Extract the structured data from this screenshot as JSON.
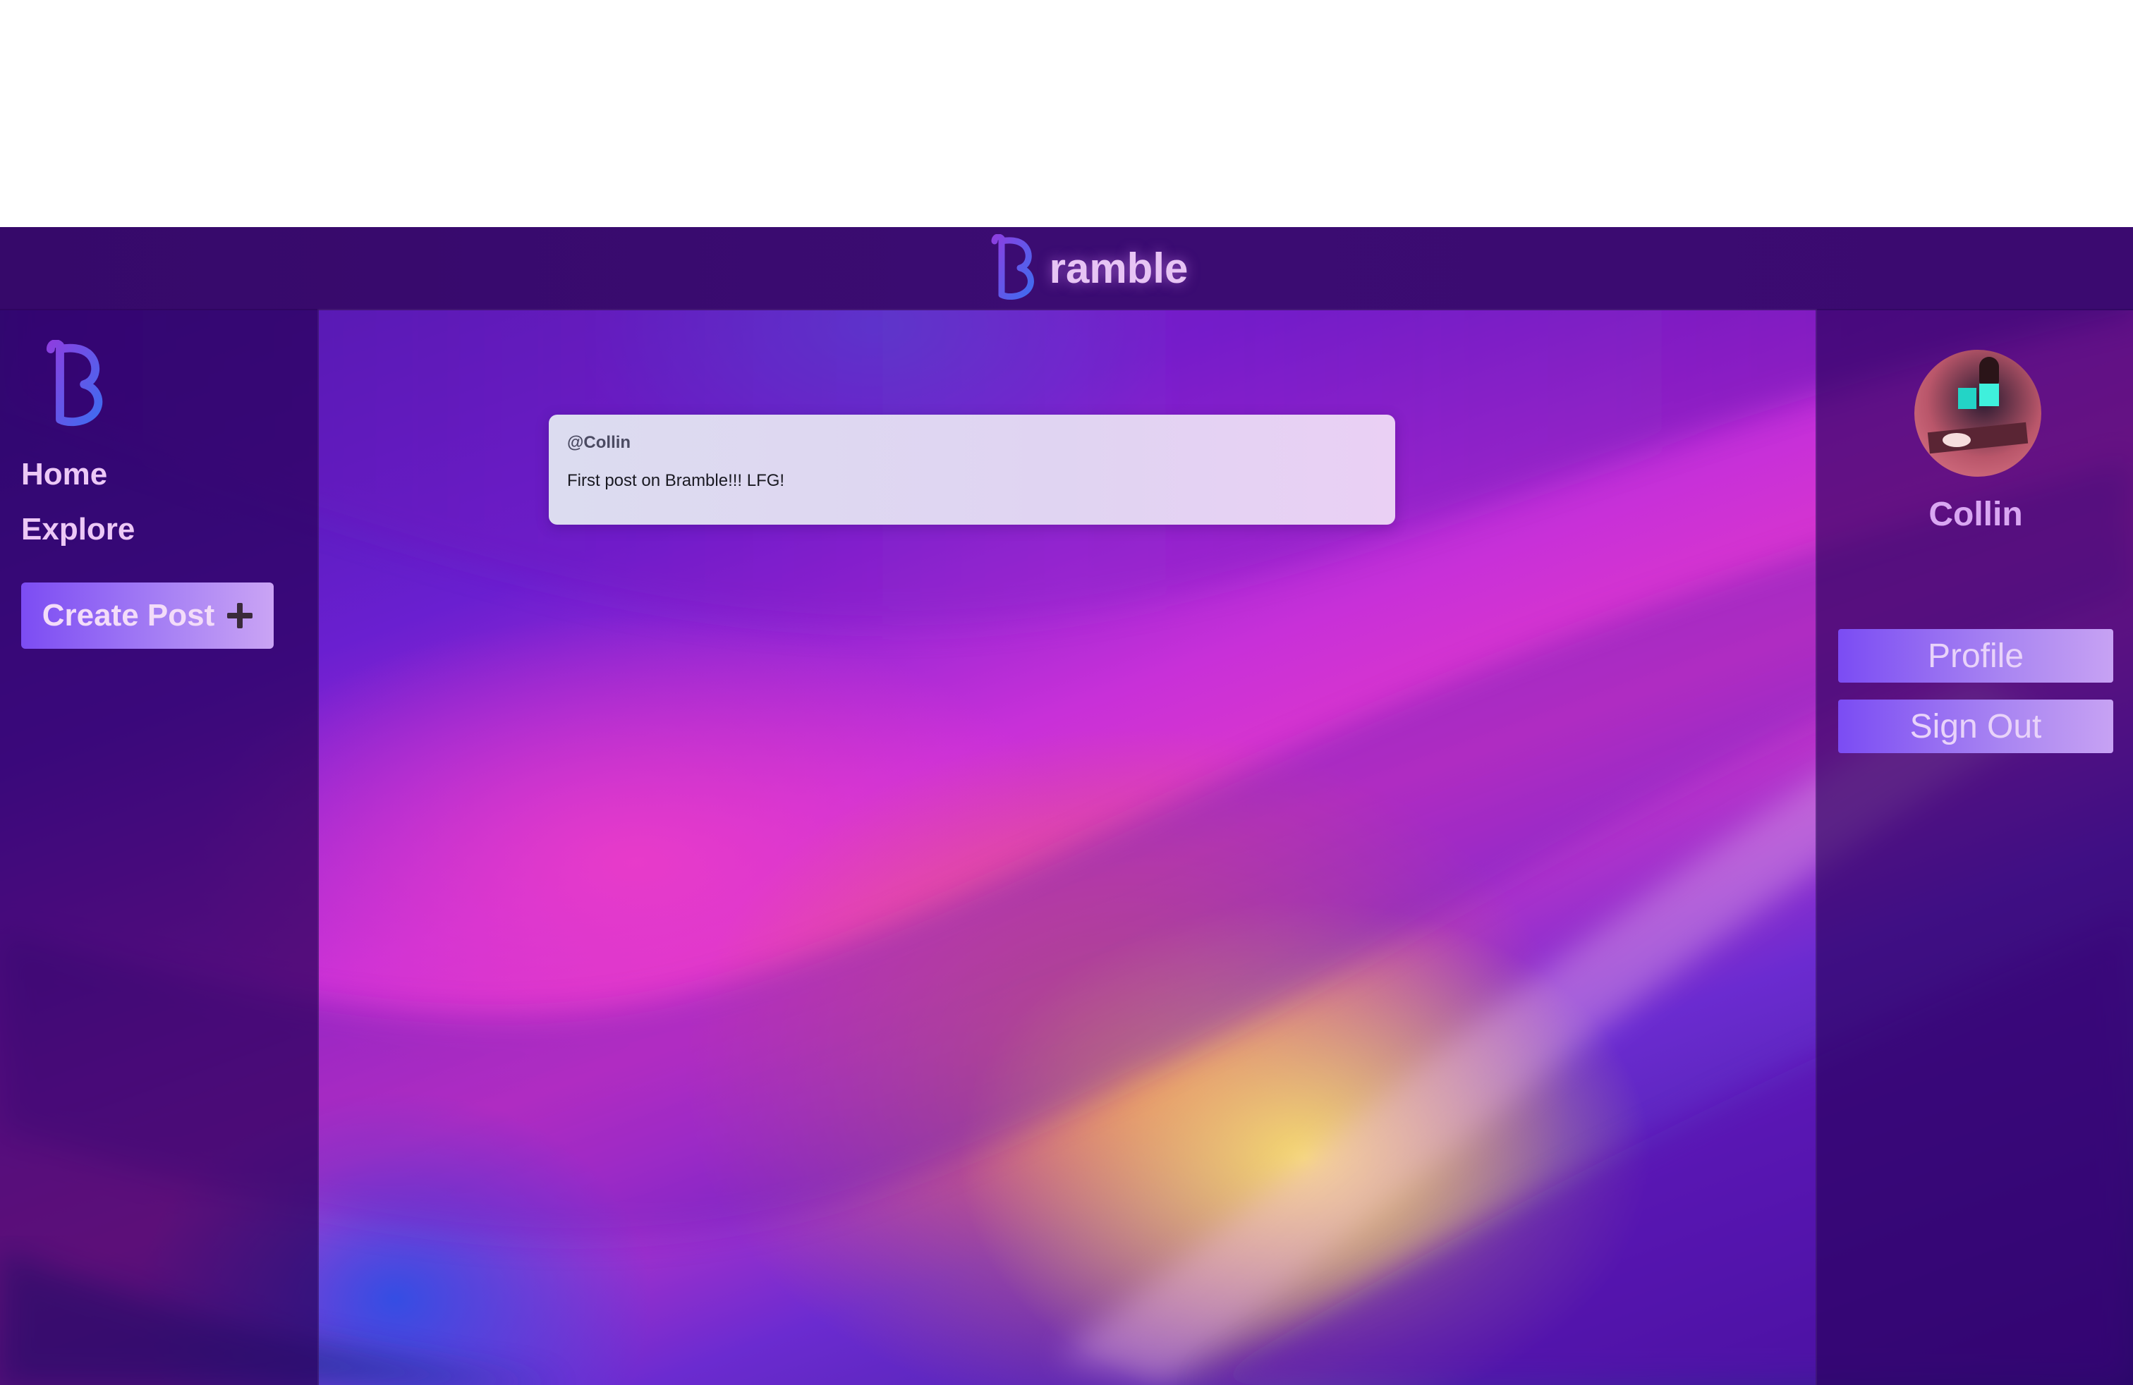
{
  "app": {
    "brand_name": "ramble",
    "logo_letter": "B"
  },
  "sidebar": {
    "items": [
      {
        "label": "Home"
      },
      {
        "label": "Explore"
      }
    ],
    "create_post_label": "Create Post"
  },
  "feed": {
    "posts": [
      {
        "handle": "@Collin",
        "text": "First post on Bramble!!! LFG!"
      }
    ]
  },
  "user_panel": {
    "name": "Collin",
    "profile_label": "Profile",
    "signout_label": "Sign Out"
  },
  "colors": {
    "header_bg": "#3b0c72",
    "accent": "#7c4cf3",
    "brand_text": "#e7c4f4"
  },
  "icons": [
    "bramble-logo-icon",
    "plus-icon",
    "user-avatar"
  ]
}
